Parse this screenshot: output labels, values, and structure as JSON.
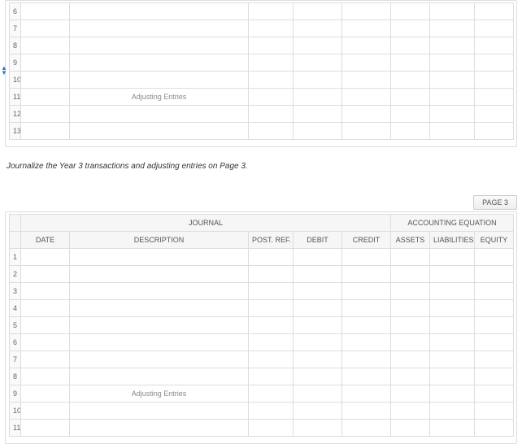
{
  "top_table": {
    "rows": [
      {
        "num": "6",
        "desc": ""
      },
      {
        "num": "7",
        "desc": ""
      },
      {
        "num": "8",
        "desc": ""
      },
      {
        "num": "9",
        "desc": ""
      },
      {
        "num": "10",
        "desc": ""
      },
      {
        "num": "11",
        "desc": "Adjusting Entries"
      },
      {
        "num": "12",
        "desc": ""
      },
      {
        "num": "13",
        "desc": ""
      }
    ]
  },
  "instruction_text": "Journalize the Year 3 transactions and adjusting entries on Page 3.",
  "page_badge": "PAGE 3",
  "titles": {
    "journal": "JOURNAL",
    "equation": "ACCOUNTING EQUATION"
  },
  "headers": {
    "date": "DATE",
    "description": "DESCRIPTION",
    "postref": "POST. REF.",
    "debit": "DEBIT",
    "credit": "CREDIT",
    "assets": "ASSETS",
    "liabilities": "LIABILITIES",
    "equity": "EQUITY"
  },
  "bottom_table": {
    "rows": [
      {
        "num": "1",
        "desc": ""
      },
      {
        "num": "2",
        "desc": ""
      },
      {
        "num": "3",
        "desc": ""
      },
      {
        "num": "4",
        "desc": ""
      },
      {
        "num": "5",
        "desc": ""
      },
      {
        "num": "6",
        "desc": ""
      },
      {
        "num": "7",
        "desc": ""
      },
      {
        "num": "8",
        "desc": ""
      },
      {
        "num": "9",
        "desc": "Adjusting Entries"
      },
      {
        "num": "10",
        "desc": ""
      },
      {
        "num": "11",
        "desc": ""
      }
    ]
  },
  "sort": {
    "up": "▲",
    "down": "▼"
  }
}
